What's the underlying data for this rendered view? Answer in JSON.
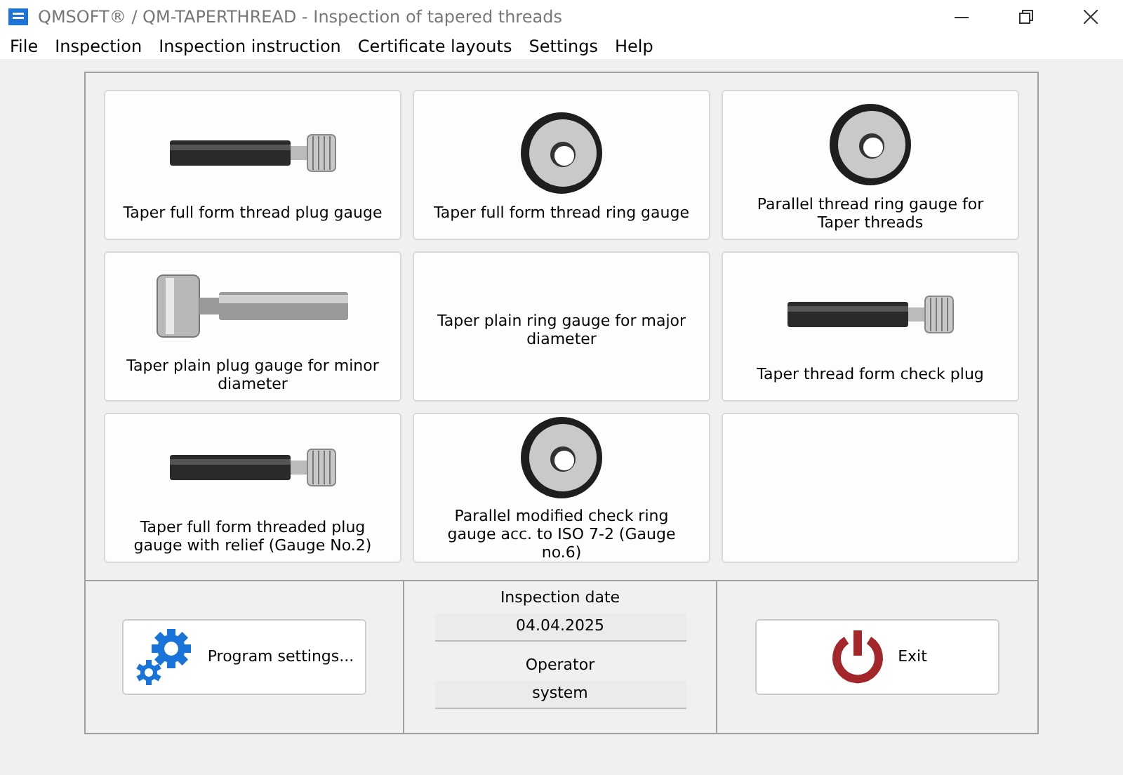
{
  "window": {
    "title": "QMSOFT® / QM-TAPERTHREAD - Inspection of tapered threads"
  },
  "menu": [
    "File",
    "Inspection",
    "Inspection instruction",
    "Certificate layouts",
    "Settings",
    "Help"
  ],
  "tiles": [
    {
      "kind": "plug",
      "label": "Taper full form thread plug gauge"
    },
    {
      "kind": "ring",
      "label": "Taper full form thread ring gauge"
    },
    {
      "kind": "ring",
      "label": "Parallel thread ring gauge for Taper threads"
    },
    {
      "kind": "plain_plug",
      "label": "Taper plain plug gauge for minor diameter"
    },
    {
      "kind": "none",
      "label": "Taper plain ring gauge for major diameter"
    },
    {
      "kind": "plug",
      "label": "Taper thread form check plug"
    },
    {
      "kind": "plug",
      "label": "Taper full form threaded plug gauge with relief (Gauge No.2)"
    },
    {
      "kind": "ring",
      "label": "Parallel modified check ring gauge acc. to ISO 7-2 (Gauge no.6)"
    },
    {
      "kind": "empty"
    }
  ],
  "settings_button": "Program settings...",
  "inspection_date": {
    "label": "Inspection date",
    "value": "04.04.2025"
  },
  "operator": {
    "label": "Operator",
    "value": "system"
  },
  "exit_button": "Exit"
}
